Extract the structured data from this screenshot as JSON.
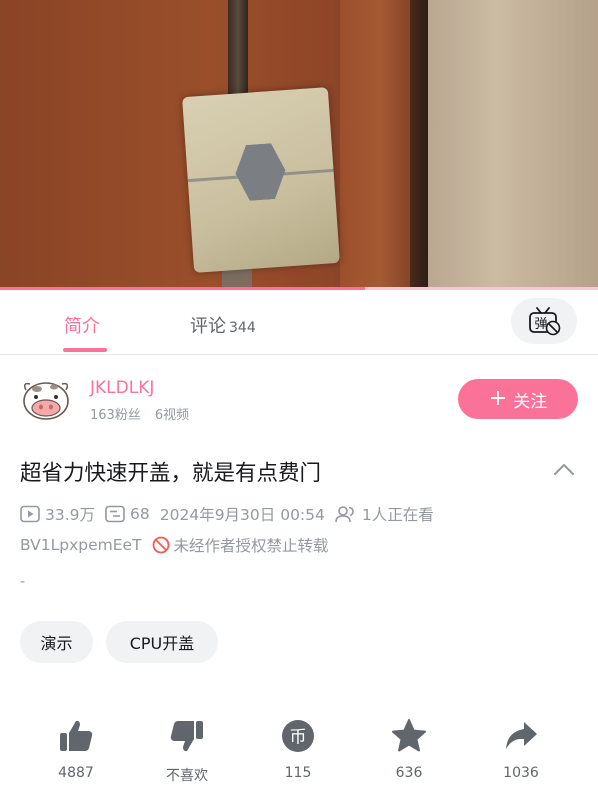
{
  "player": {
    "progress_percent": 61
  },
  "tabs": {
    "intro_label": "简介",
    "comments_label": "评论",
    "comments_count": "344"
  },
  "danmaku": {
    "icon": "danmaku-off-icon",
    "label": "弹"
  },
  "uploader": {
    "name": "JKLDLKJ",
    "fans": "163粉丝",
    "videos": "6视频",
    "follow_label": "关注"
  },
  "video": {
    "title": "超省力快速开盖，就是有点费门",
    "views": "33.9万",
    "danmaku_count": "68",
    "date": "2024年9月30日 00:54",
    "watching": "1人正在看",
    "bvid": "BV1LpxpemEeT",
    "no_repost": "未经作者授权禁止转载",
    "description": "-"
  },
  "tags": [
    "演示",
    "CPU开盖"
  ],
  "actions": [
    {
      "icon": "thumbs-up-icon",
      "label": "4887"
    },
    {
      "icon": "thumbs-down-icon",
      "label": "不喜欢"
    },
    {
      "icon": "coin-icon",
      "label": "115",
      "glyph": "币"
    },
    {
      "icon": "star-icon",
      "label": "636"
    },
    {
      "icon": "share-icon",
      "label": "1036"
    }
  ],
  "colors": {
    "accent": "#fb7299",
    "muted": "#9499a0",
    "text": "#18191c",
    "icon": "#61666d",
    "warning": "#f85a54"
  }
}
